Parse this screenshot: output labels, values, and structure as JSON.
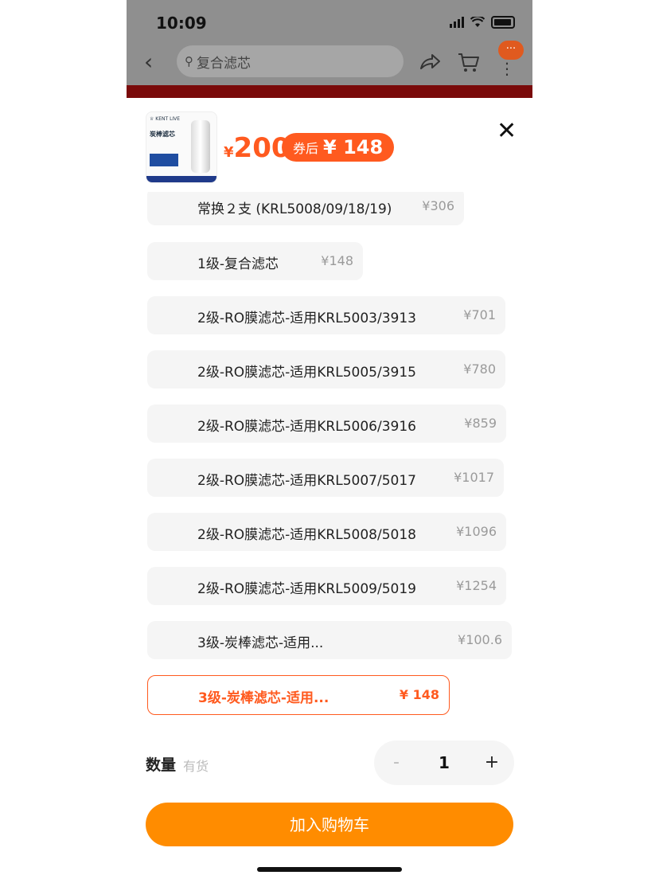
{
  "status": {
    "time": "10:09"
  },
  "nav": {
    "search_placeholder": "复合滤芯",
    "badge": "···"
  },
  "product": {
    "thumb_brand": "♕ KENT LIVE",
    "thumb_name": "炭棒滤芯",
    "currency": "¥",
    "price": "200",
    "coupon_label": "券后",
    "coupon_price": "¥ 148"
  },
  "options": [
    {
      "text": "常换２支 (KRL5008/09/18/19)",
      "price": "¥306"
    },
    {
      "text": "1级-复合滤芯",
      "price": "¥148"
    },
    {
      "text": "2级-RO膜滤芯-适用KRL5003/3913",
      "price": "¥701"
    },
    {
      "text": "2级-RO膜滤芯-适用KRL5005/3915",
      "price": "¥780"
    },
    {
      "text": "2级-RO膜滤芯-适用KRL5006/3916",
      "price": "¥859"
    },
    {
      "text": "2级-RO膜滤芯-适用KRL5007/5017",
      "price": "¥1017"
    },
    {
      "text": "2级-RO膜滤芯-适用KRL5008/5018",
      "price": "¥1096"
    },
    {
      "text": "2级-RO膜滤芯-适用KRL5009/5019",
      "price": "¥1254"
    },
    {
      "text": "3级-炭棒滤芯-适用...",
      "price": "¥100.6"
    },
    {
      "text": "3级-炭棒滤芯-适用...",
      "price": "¥ 148",
      "selected": true
    }
  ],
  "quantity": {
    "label": "数量",
    "stock": "有货",
    "minus": "-",
    "value": "1",
    "plus": "+"
  },
  "cart_button": "加入购物车",
  "colors": {
    "accent": "#ff5a1f",
    "cart": "#ff8c00"
  }
}
